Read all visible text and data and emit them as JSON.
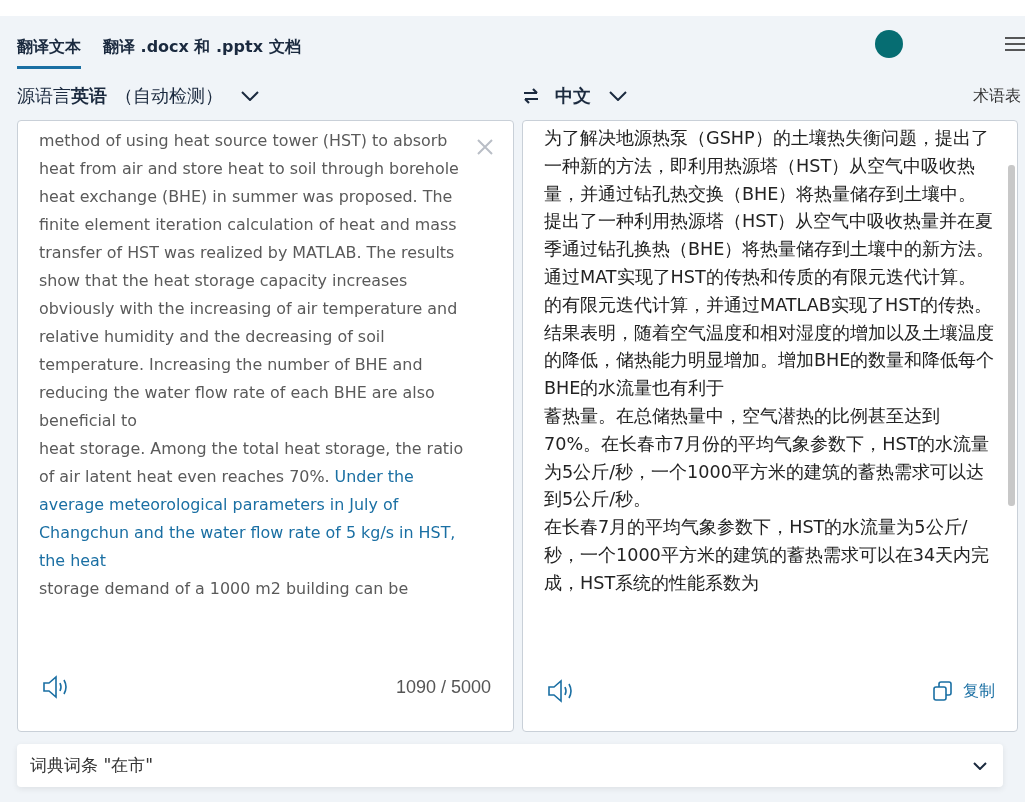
{
  "tabs": [
    {
      "label": "翻译文本",
      "selected": true
    },
    {
      "label": "翻译 .docx 和 .pptx 文档",
      "selected": false
    }
  ],
  "source_language": {
    "prefix": "源语言",
    "language": "英语",
    "note": "（自动检测）"
  },
  "target_language": {
    "language": "中文"
  },
  "glossary_link": "术语表",
  "source_text": [
    [
      {
        "text": "method of using heat source tower (HST) to absorb heat from air and store heat to soil through borehole",
        "highlighted": false
      }
    ],
    [
      {
        "text": "heat exchange (BHE) in summer was proposed. The finite element iteration calculation of heat and mass",
        "highlighted": false
      }
    ],
    [
      {
        "text": "transfer of HST was realized by MATLAB. The results show that the heat storage capacity increases obviously with the increasing of air temperature and relative humidity and the decreasing of soil temperature. Increasing the number of BHE and reducing the water flow rate of each BHE are also beneficial to",
        "highlighted": false
      }
    ],
    [
      {
        "text": "heat storage. Among the total heat storage, the ratio of air latent heat even reaches 70%. ",
        "highlighted": false
      },
      {
        "text": "Under the average meteorological parameters in July of Changchun and the water flow rate of 5 kg/s in HST, the heat",
        "highlighted": true
      }
    ],
    [
      {
        "text": "storage demand of a 1000 m2 building can be",
        "highlighted": false
      }
    ]
  ],
  "char_count": "1090 / 5000",
  "target_text": [
    "为了解决地源热泵（GSHP）的土壤热失衡问题，提出了一种新的方法，即利用热源塔（HST）从空气中吸收热量，并通过钻孔热交换（BHE）将热量储存到土壤中。",
    "提出了一种利用热源塔（HST）从空气中吸收热量并在夏季通过钻孔换热（BHE）将热量储存到土壤中的新方法。通过MAT实现了HST的传热和传质的有限元迭代计算。",
    "的有限元迭代计算，并通过MATLAB实现了HST的传热。结果表明，随着空气温度和相对湿度的增加以及土壤温度的降低，储热能力明显增加。增加BHE的数量和降低每个BHE的水流量也有利于",
    "蓄热量。在总储热量中，空气潜热的比例甚至达到70%。在长春市7月份的平均气象参数下，HST的水流量为5公斤/秒，一个1000平方米的建筑的蓄热需求可以达到5公斤/秒。",
    "在长春7月的平均气象参数下，HST的水流量为5公斤/秒，一个1000平方米的建筑的蓄热需求可以在34天内完成，HST系统的性能系数为"
  ],
  "copy_button": "复制",
  "dictionary_bar": {
    "label": "词典词条 \"在市\"",
    "expanded": false
  }
}
